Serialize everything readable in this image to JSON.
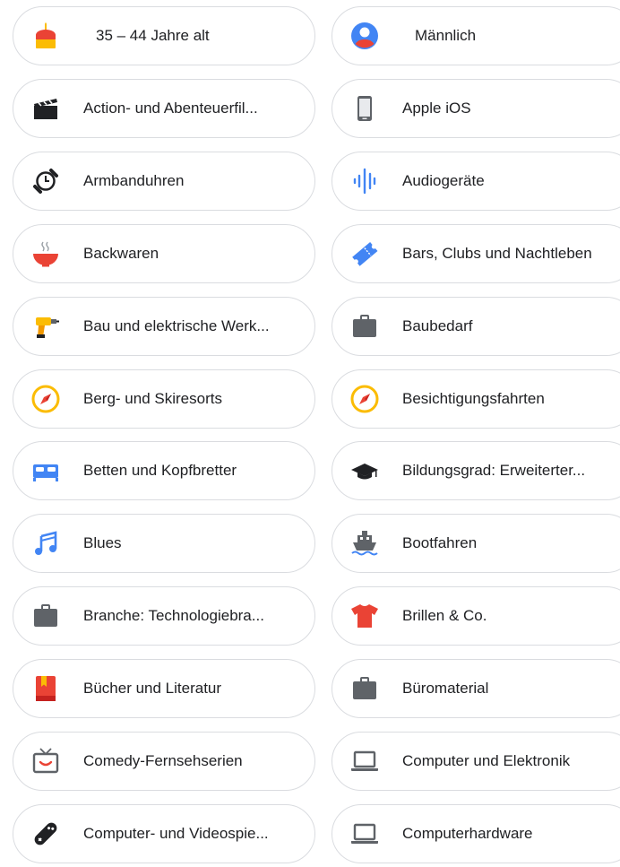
{
  "chips": [
    {
      "label": "35 – 44 Jahre alt",
      "icon": "birthday-cake-icon"
    },
    {
      "label": "Männlich",
      "icon": "account-circle-icon"
    },
    {
      "label": "Action- und Abenteuerfil...",
      "icon": "clapperboard-icon"
    },
    {
      "label": "Apple iOS",
      "icon": "smartphone-icon"
    },
    {
      "label": "Armbanduhren",
      "icon": "wristwatch-icon"
    },
    {
      "label": "Audiogeräte",
      "icon": "audio-wave-icon"
    },
    {
      "label": "Backwaren",
      "icon": "hot-bowl-icon"
    },
    {
      "label": "Bars, Clubs und Nachtleben",
      "icon": "ticket-icon"
    },
    {
      "label": "Bau und elektrische Werk...",
      "icon": "power-drill-icon"
    },
    {
      "label": "Baubedarf",
      "icon": "briefcase-icon"
    },
    {
      "label": "Berg- und Skiresorts",
      "icon": "compass-icon"
    },
    {
      "label": "Besichtigungsfahrten",
      "icon": "compass-icon"
    },
    {
      "label": "Betten und Kopfbretter",
      "icon": "bed-icon"
    },
    {
      "label": "Bildungsgrad: Erweiterter...",
      "icon": "graduation-cap-icon"
    },
    {
      "label": "Blues",
      "icon": "music-note-icon"
    },
    {
      "label": "Bootfahren",
      "icon": "ship-icon"
    },
    {
      "label": "Branche: Technologiebra...",
      "icon": "briefcase-icon"
    },
    {
      "label": "Brillen & Co.",
      "icon": "tshirt-icon"
    },
    {
      "label": "Bücher und Literatur",
      "icon": "book-icon"
    },
    {
      "label": "Büromaterial",
      "icon": "briefcase-icon"
    },
    {
      "label": "Comedy-Fernsehserien",
      "icon": "tv-icon"
    },
    {
      "label": "Computer und Elektronik",
      "icon": "laptop-icon"
    },
    {
      "label": "Computer- und Videospie...",
      "icon": "gamepad-icon"
    },
    {
      "label": "Computerhardware",
      "icon": "laptop-icon"
    }
  ],
  "colors": {
    "border": "#dadce0",
    "text": "#202124",
    "google_blue": "#4285f4",
    "google_red": "#ea4335",
    "google_yellow": "#fbbc04",
    "dark_gray": "#5f6368"
  }
}
